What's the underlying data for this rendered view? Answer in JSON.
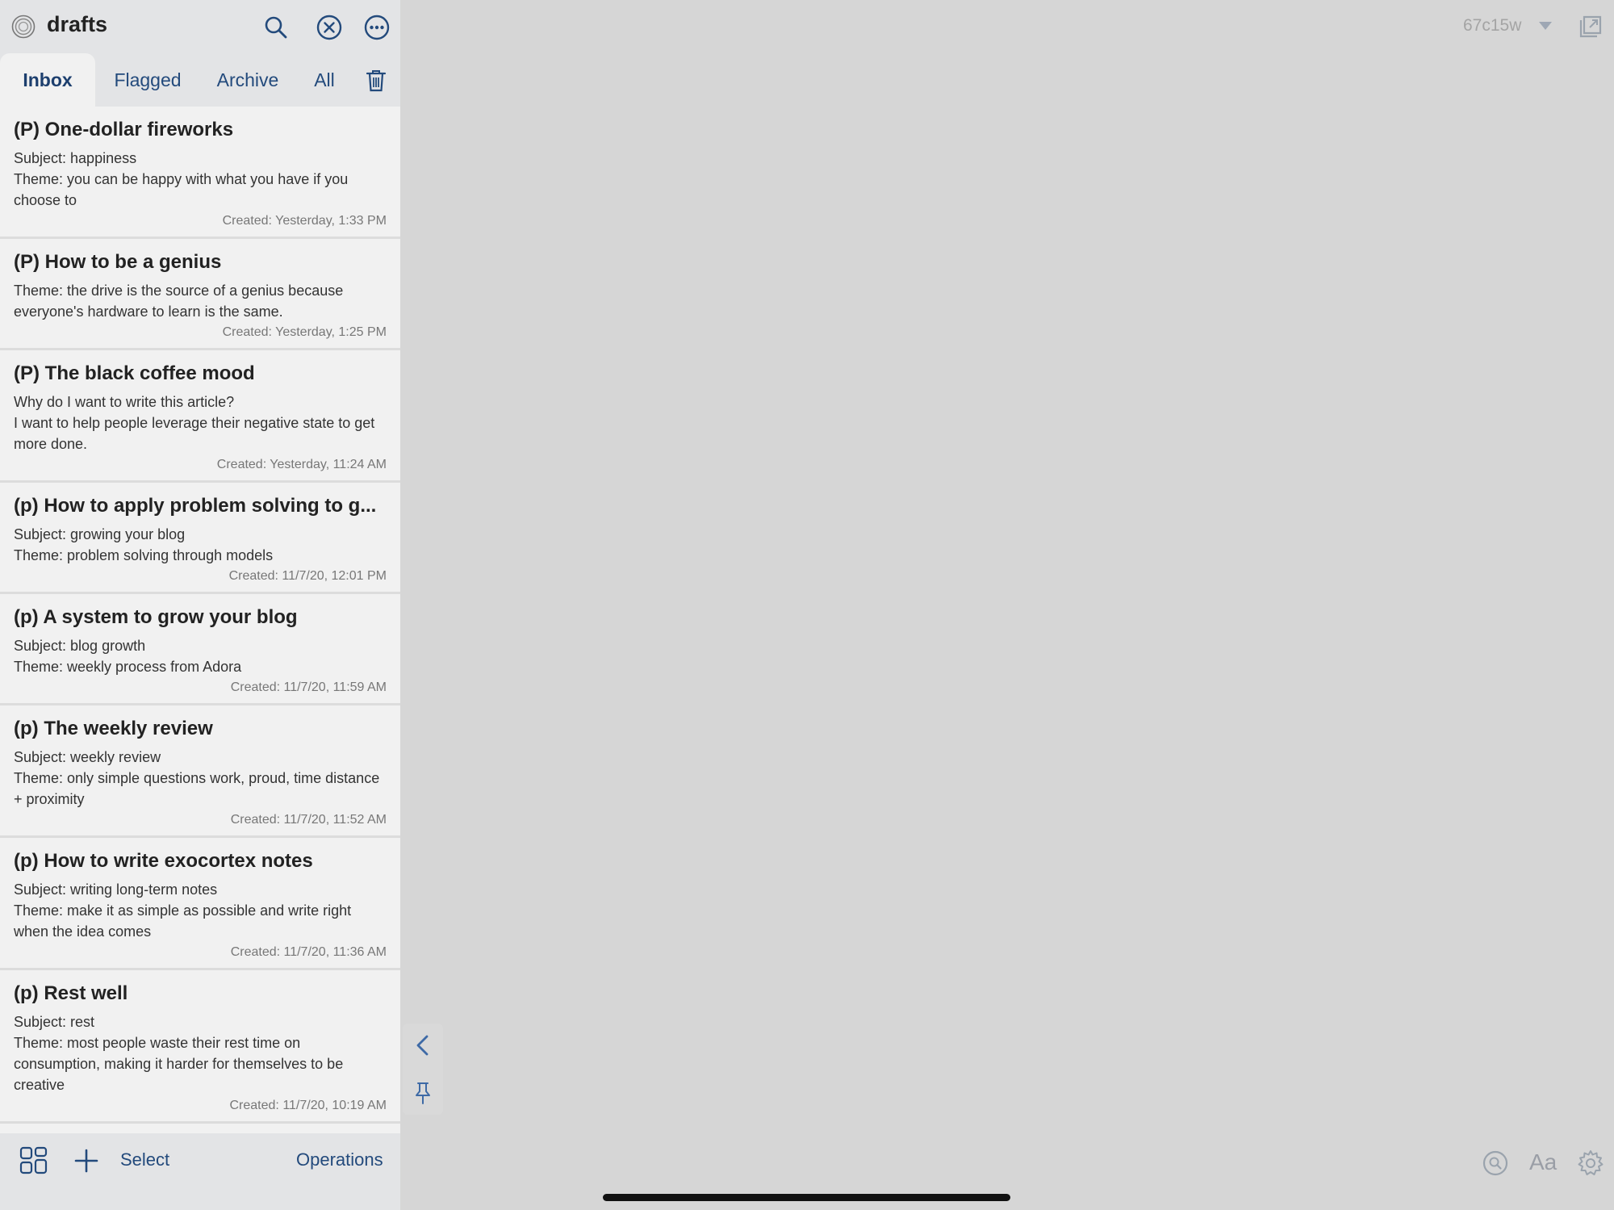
{
  "app": {
    "title": "drafts"
  },
  "tabs": [
    {
      "label": "Inbox",
      "active": true
    },
    {
      "label": "Flagged",
      "active": false
    },
    {
      "label": "Archive",
      "active": false
    },
    {
      "label": "All",
      "active": false
    }
  ],
  "drafts": [
    {
      "title": "(P) One-dollar fireworks",
      "lines": [
        "Subject: happiness",
        "Theme: you can be happy with what you have if you choose to"
      ],
      "created": "Created: Yesterday, 1:33 PM"
    },
    {
      "title": "(P) How to be a genius",
      "lines": [
        "Theme: the drive is the source of a genius because everyone's hardware to learn is the same."
      ],
      "created": "Created: Yesterday, 1:25 PM"
    },
    {
      "title": "(P) The black coffee mood",
      "lines": [
        "Why do I want to write this article?",
        "I want to help people leverage their negative state to get more done."
      ],
      "created": "Created: Yesterday, 11:24 AM"
    },
    {
      "title": "(p) How to apply problem solving to g...",
      "lines": [
        "Subject: growing your blog",
        "Theme: problem solving through models"
      ],
      "created": "Created: 11/7/20, 12:01 PM"
    },
    {
      "title": "(p) A system to grow your blog",
      "lines": [
        "Subject: blog growth",
        "Theme: weekly process from Adora"
      ],
      "created": "Created: 11/7/20, 11:59 AM"
    },
    {
      "title": "(p) The weekly review",
      "lines": [
        "Subject: weekly review",
        "Theme: only simple questions work, proud, time distance + proximity"
      ],
      "created": "Created: 11/7/20, 11:52 AM"
    },
    {
      "title": "(p) How to write exocortex notes",
      "lines": [
        "Subject: writing long-term notes",
        "Theme: make it as simple as possible and write right when the idea comes"
      ],
      "created": "Created: 11/7/20, 11:36 AM"
    },
    {
      "title": "(p) Rest well",
      "lines": [
        "Subject: rest",
        "Theme: most people waste their rest time on consumption, making it harder for themselves to be creative"
      ],
      "created": "Created: 11/7/20, 10:19 AM"
    }
  ],
  "bottombar": {
    "select_label": "Select",
    "operations_label": "Operations"
  },
  "editor": {
    "workspace_label": "67c15w",
    "font_button_label": "Aa"
  },
  "colors": {
    "accent": "#234a7c",
    "sidebar_bg": "#f1f1f1",
    "bar_bg": "#e3e4e6",
    "editor_bg": "#d6d6d6"
  }
}
